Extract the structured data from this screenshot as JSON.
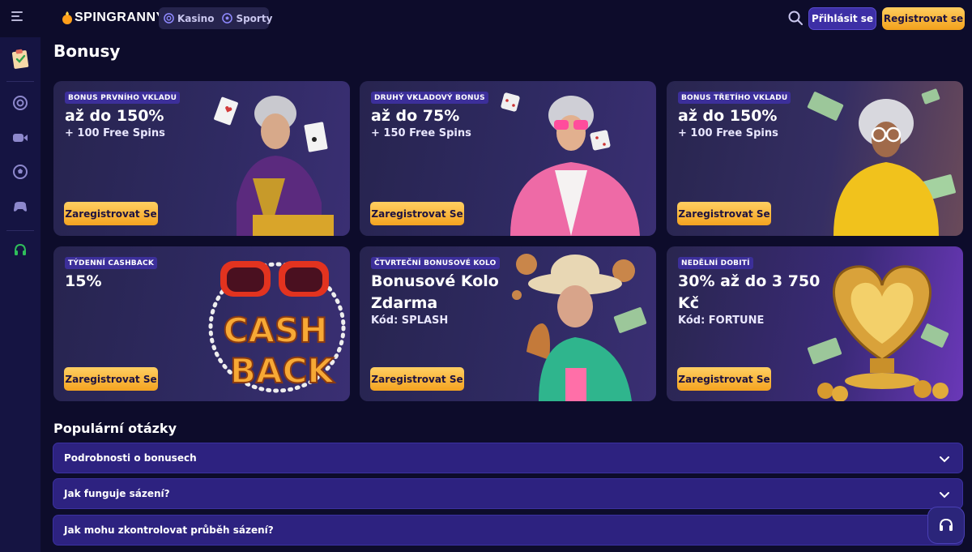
{
  "header": {
    "brand_prefix": "SPIN",
    "brand_suffix": "GRANNY",
    "nav": [
      {
        "label": "Kasino",
        "icon": "casino-chip-icon"
      },
      {
        "label": "Sporty",
        "icon": "soccer-ball-icon"
      }
    ],
    "login_label": "Přihlásit se",
    "register_label": "Registrovat se"
  },
  "siderail": {
    "items": [
      "promotions-icon",
      "roulette-icon",
      "live-casino-icon",
      "sports-icon",
      "esports-icon",
      "support-icon"
    ]
  },
  "page": {
    "title": "Bonusy"
  },
  "bonuses": [
    {
      "badge": "BONUS PRVNÍHO VKLADU",
      "headline": "až do 150%",
      "sub": "+ 100 Free Spins",
      "cta": "Zaregistrovat Se"
    },
    {
      "badge": "DRUHÝ VKLADOVÝ BONUS",
      "headline": "až do 75%",
      "sub": "+ 150 Free Spins",
      "cta": "Zaregistrovat Se"
    },
    {
      "badge": "BONUS TŘETÍHO VKLADU",
      "headline": "až do 150%",
      "sub": "+ 100 Free Spins",
      "cta": "Zaregistrovat Se"
    },
    {
      "badge": "TÝDENNÍ CASHBACK",
      "headline": "15%",
      "sub": "",
      "cta": "Zaregistrovat Se",
      "art_text_1": "CASH",
      "art_text_2": "BACK"
    },
    {
      "badge": "ČTVRTEČNÍ BONUSOVÉ KOLO",
      "headline": "Bonusové Kolo Zdarma",
      "sub": "Kód: SPLASH",
      "cta": "Zaregistrovat Se"
    },
    {
      "badge": "NEDĚLNÍ DOBITÍ",
      "headline": "30% až do 3 750 Kč",
      "sub": "Kód: FORTUNE",
      "cta": "Zaregistrovat Se"
    }
  ],
  "faq": {
    "title": "Populární otázky",
    "items": [
      "Podrobnosti o bonusech",
      "Jak funguje sázení?",
      "Jak mohu zkontrolovat průběh sázení?"
    ]
  },
  "colors": {
    "background": "#0d0c2b",
    "accent_orange": "#f4a320",
    "accent_purple": "#3d2fa6"
  }
}
